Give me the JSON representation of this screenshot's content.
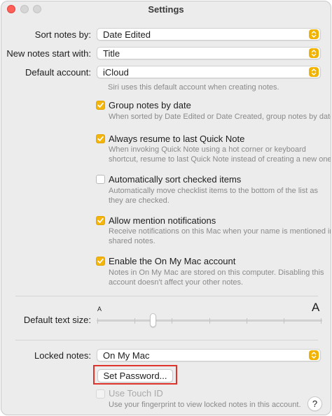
{
  "window": {
    "title": "Settings"
  },
  "sort": {
    "label": "Sort notes by:",
    "value": "Date Edited"
  },
  "new_notes": {
    "label": "New notes start with:",
    "value": "Title"
  },
  "account": {
    "label": "Default account:",
    "value": "iCloud",
    "note": "Siri uses this default account when creating notes."
  },
  "options": [
    {
      "label": "Group notes by date",
      "checked": true,
      "note_lines": [
        "When sorted by Date Edited or Date Created, group notes by date."
      ]
    },
    {
      "label": "Always resume to last Quick Note",
      "checked": true,
      "note_lines": [
        "When invoking Quick Note using a hot corner or keyboard",
        "shortcut, resume to last Quick Note instead of creating a new one."
      ]
    },
    {
      "label": "Automatically sort checked items",
      "checked": false,
      "note_lines": [
        "Automatically move checklist items to the bottom of the list as",
        "they are checked."
      ]
    },
    {
      "label": "Allow mention notifications",
      "checked": true,
      "note_lines": [
        "Receive notifications on this Mac when your name is mentioned in",
        "shared notes."
      ]
    },
    {
      "label": "Enable the On My Mac account",
      "checked": true,
      "note_lines": [
        "Notes in On My Mac are stored on this computer. Disabling this",
        "account doesn't affect your other notes."
      ]
    }
  ],
  "text_size": {
    "label": "Default text size:",
    "small_glyph": "A",
    "large_glyph": "A",
    "level": 0.25,
    "steps": 7
  },
  "locked": {
    "label": "Locked notes:",
    "value": "On My Mac",
    "set_password": "Set Password...",
    "touch_id": {
      "label": "Use Touch ID",
      "checked": false,
      "enabled": false
    },
    "note": "Use your fingerprint to view locked notes in this account."
  },
  "help_label": "?",
  "colors": {
    "accent": "#f5b50a",
    "highlight": "#e0332c"
  }
}
